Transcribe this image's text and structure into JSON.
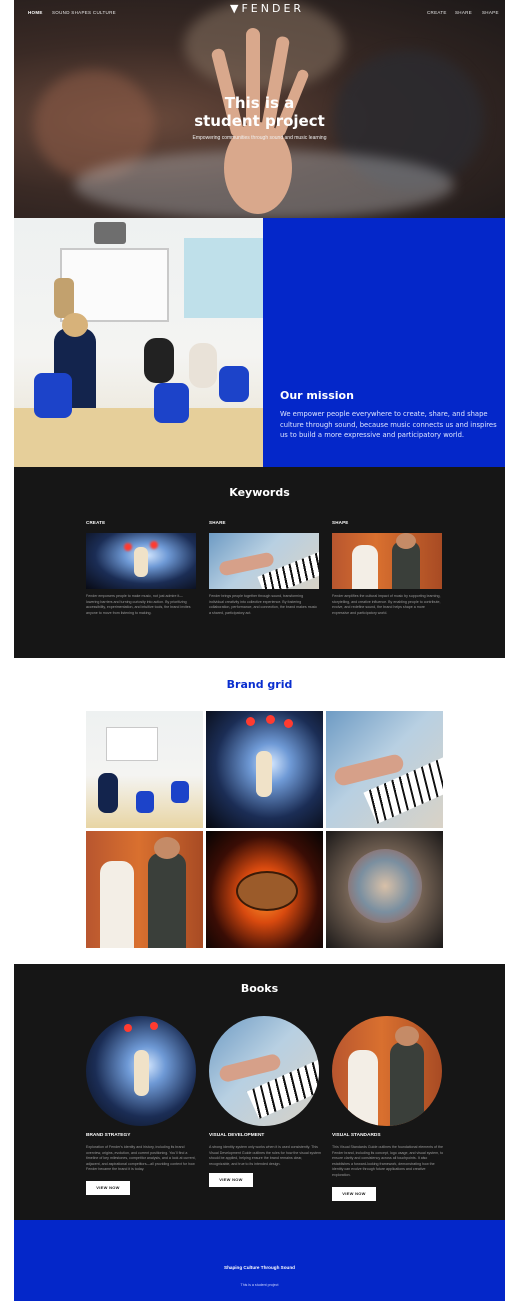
{
  "nav": {
    "left": [
      "HOME",
      "SOUND SHAPES CULTURE"
    ],
    "logo": "FENDER",
    "right": [
      "CREATE",
      "SHARE",
      "SHAPE"
    ]
  },
  "hero": {
    "title_line1": "This is a",
    "title_line2": "student project",
    "subtitle": "Empowering communities through sound and music learning"
  },
  "mission": {
    "heading": "Our mission",
    "body": "We empower people everywhere to create, share, and shape culture through sound, because music connects us and inspires us to build a more expressive and participatory world."
  },
  "keywords": {
    "title": "Keywords",
    "items": [
      {
        "label": "CREATE",
        "text": "Fender empowers people to make music, not just admire it—lowering barriers and turning curiosity into action. By prioritizing accessibility, experimentation, and intuitive tools, the brand invites anyone to move from listening to making."
      },
      {
        "label": "SHARE",
        "text": "Fender brings people together through sound, transforming individual creativity into collective experience. By fostering collaboration, performance, and connection, the brand makes music a shared, participatory act."
      },
      {
        "label": "SHAPE",
        "text": "Fender amplifies the cultural impact of music by supporting learning, storytelling, and creative influence. By enabling people to contribute, evolve, and redefine sound, the brand helps shape a more expressive and participatory world."
      }
    ]
  },
  "brand_grid": {
    "title": "Brand grid"
  },
  "books": {
    "title": "Books",
    "items": [
      {
        "label": "BRAND STRATEGY",
        "text": "Exploration of Fender's identity and history, including its brand overview, origins, evolution, and current positioning. You'll find a timeline of key milestones, competitor analysis, and a look at current, adjacent, and aspirational competitors—all providing context for how Fender became the brand it is today.",
        "button": "VIEW NOW"
      },
      {
        "label": "VISUAL DEVELOPMENT",
        "text": "A strong identity system only works when it is used consistently. This Visual Development Guide outlines the rules for how the visual system should be applied, helping ensure the brand remains clear, recognizable, and true to its intended design.",
        "button": "VIEW NOW"
      },
      {
        "label": "VISUAL STANDARDS",
        "text": "This Visual Standards Guide outlines the foundational elements of the Fender brand, including its concept, logo usage, and visual system, to ensure clarity and consistency across all touchpoints. It also establishes a forward-looking framework, demonstrating how the identity can evolve through future applications and creative exploration.",
        "button": "VIEW NOW"
      }
    ]
  },
  "footer": {
    "title": "Shaping Culture Through Sound",
    "note": "This is a student project"
  }
}
